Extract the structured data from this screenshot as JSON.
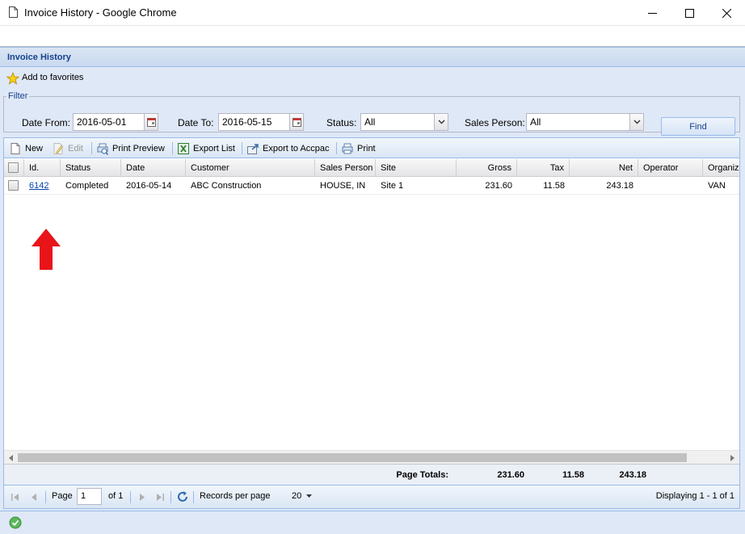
{
  "window": {
    "title": "Invoice History - Google Chrome"
  },
  "panel": {
    "title": "Invoice History",
    "favorites_label": "Add to favorites"
  },
  "filter": {
    "legend": "Filter",
    "date_from_label": "Date From:",
    "date_from_value": "2016-05-01",
    "date_to_label": "Date To:",
    "date_to_value": "2016-05-15",
    "status_label": "Status:",
    "status_value": "All",
    "sales_person_label": "Sales Person:",
    "sales_person_value": "All",
    "find_label": "Find"
  },
  "toolbar": {
    "new_label": "New",
    "edit_label": "Edit",
    "print_preview_label": "Print Preview",
    "export_list_label": "Export List",
    "export_accpac_label": "Export to Accpac",
    "print_label": "Print"
  },
  "grid": {
    "columns": [
      "Id.",
      "Status",
      "Date",
      "Customer",
      "Sales Person",
      "Site",
      "Gross",
      "Tax",
      "Net",
      "Operator",
      "Organiza"
    ],
    "rows": [
      {
        "id": "6142",
        "status": "Completed",
        "date": "2016-05-14",
        "customer": "ABC Construction",
        "sales_person": "HOUSE, IN",
        "site": "Site 1",
        "gross": "231.60",
        "tax": "11.58",
        "net": "243.18",
        "operator": "",
        "organization": "VAN"
      }
    ]
  },
  "totals": {
    "label": "Page Totals:",
    "gross": "231.60",
    "tax": "11.58",
    "net": "243.18"
  },
  "pager": {
    "page_label": "Page",
    "page_value": "1",
    "of_label": "of 1",
    "records_label": "Records per page",
    "records_value": "20",
    "displaying": "Displaying 1 - 1 of 1"
  },
  "colors": {
    "panel_title": "#15428b",
    "accent_border": "#99bbe8",
    "annotation_arrow": "#e8141a",
    "link": "#0645ad"
  }
}
